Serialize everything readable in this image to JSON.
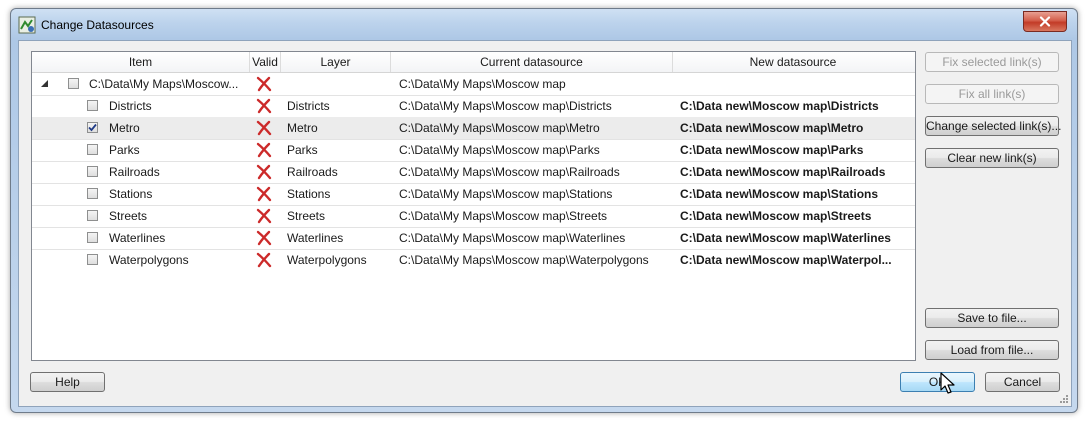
{
  "window": {
    "title": "Change Datasources"
  },
  "columns": [
    "Item",
    "Valid",
    "Layer",
    "Current datasource",
    "New datasource"
  ],
  "root": {
    "item": "C:\\Data\\My Maps\\Moscow...",
    "current": "C:\\Data\\My Maps\\Moscow map",
    "checked": false,
    "valid": false
  },
  "rows": [
    {
      "item": "Districts",
      "layer": "Districts",
      "current": "C:\\Data\\My Maps\\Moscow map\\Districts",
      "new": "C:\\Data new\\Moscow map\\Districts",
      "checked": false,
      "valid": false
    },
    {
      "item": "Metro",
      "layer": "Metro",
      "current": "C:\\Data\\My Maps\\Moscow map\\Metro",
      "new": "C:\\Data new\\Moscow map\\Metro",
      "checked": true,
      "valid": false
    },
    {
      "item": "Parks",
      "layer": "Parks",
      "current": "C:\\Data\\My Maps\\Moscow map\\Parks",
      "new": "C:\\Data new\\Moscow map\\Parks",
      "checked": false,
      "valid": false
    },
    {
      "item": "Railroads",
      "layer": "Railroads",
      "current": "C:\\Data\\My Maps\\Moscow map\\Railroads",
      "new": "C:\\Data new\\Moscow map\\Railroads",
      "checked": false,
      "valid": false
    },
    {
      "item": "Stations",
      "layer": "Stations",
      "current": "C:\\Data\\My Maps\\Moscow map\\Stations",
      "new": "C:\\Data new\\Moscow map\\Stations",
      "checked": false,
      "valid": false
    },
    {
      "item": "Streets",
      "layer": "Streets",
      "current": "C:\\Data\\My Maps\\Moscow map\\Streets",
      "new": "C:\\Data new\\Moscow map\\Streets",
      "checked": false,
      "valid": false
    },
    {
      "item": "Waterlines",
      "layer": "Waterlines",
      "current": "C:\\Data\\My Maps\\Moscow map\\Waterlines",
      "new": "C:\\Data new\\Moscow map\\Waterlines",
      "checked": false,
      "valid": false
    },
    {
      "item": "Waterpolygons",
      "layer": "Waterpolygons",
      "current": "C:\\Data\\My Maps\\Moscow map\\Waterpolygons",
      "new": "C:\\Data new\\Moscow map\\Waterpol...",
      "checked": false,
      "valid": false
    }
  ],
  "buttons": {
    "fix_selected": "Fix selected link(s)",
    "fix_all": "Fix all link(s)",
    "change_selected": "Change selected link(s)...",
    "clear_new": "Clear new link(s)",
    "save_to_file": "Save to file...",
    "load_from_file": "Load from file...",
    "help": "Help",
    "ok": "OK",
    "cancel": "Cancel"
  },
  "colors": {
    "invalid_x": "#cc2a2a",
    "selected_row": "#ececec",
    "titlebar": "#bcd3ec"
  }
}
